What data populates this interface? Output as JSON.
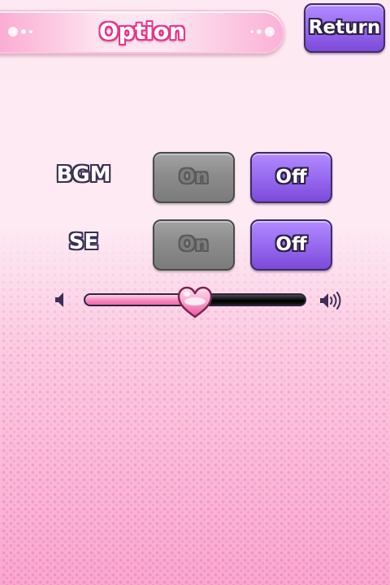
{
  "header": {
    "title": "Option",
    "return_label": "Return"
  },
  "settings": {
    "bgm": {
      "label": "BGM",
      "on_label": "On",
      "off_label": "Off",
      "selected": "Off"
    },
    "se": {
      "label": "SE",
      "on_label": "On",
      "off_label": "Off",
      "selected": "Off"
    }
  },
  "volume": {
    "level": 0.5,
    "min_icon": "speaker-mute-icon",
    "max_icon": "speaker-loud-icon",
    "thumb_icon": "heart-icon"
  },
  "colors": {
    "accent_purple": "#9a6df2",
    "title_pink": "#e6358d",
    "inactive_gray": "#8c8c8c",
    "slider_pink": "#f889c1"
  }
}
